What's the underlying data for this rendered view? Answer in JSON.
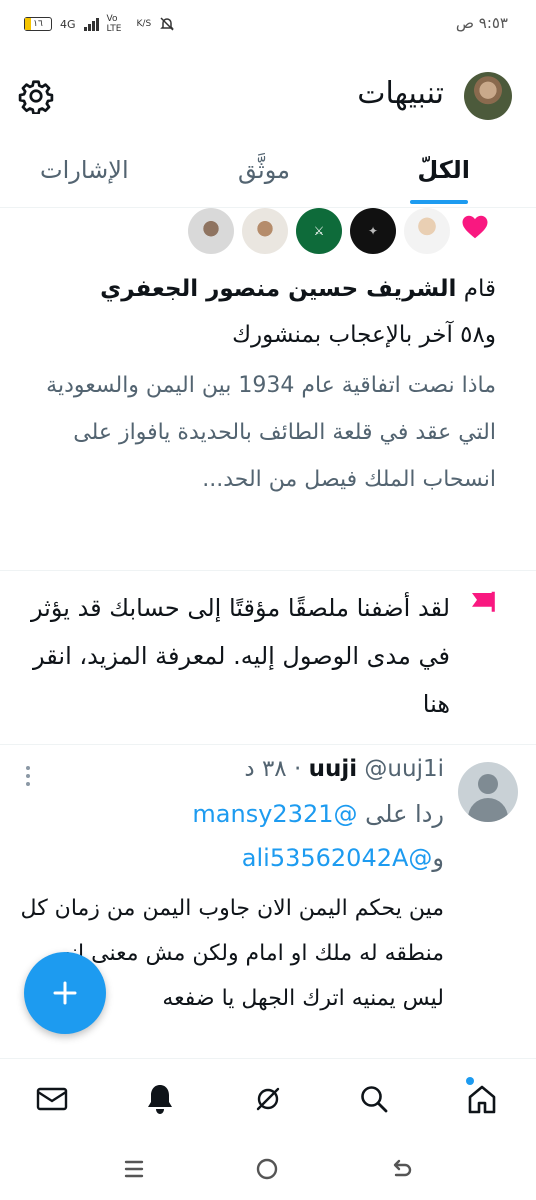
{
  "status_bar": {
    "time": "٩:٥٣ ص",
    "battery": "١٦",
    "network": "4G",
    "volte": "Vo LTE",
    "speed": "K/S"
  },
  "header": {
    "title": "تنبيهات"
  },
  "tabs": [
    {
      "label": "الكلّ",
      "active": true
    },
    {
      "label": "موثَّق",
      "active": false
    },
    {
      "label": "الإشارات",
      "active": false
    }
  ],
  "like_notification": {
    "prefix": "قام",
    "user": "الشريف حسين منصور الجعفري",
    "suffix": "و٥٨ آخر بالإعجاب بمنشورك",
    "excerpt": "ماذا نصت اتفاقية عام 1934 بين اليمن والسعودية التي عقد في قلعة الطائف بالحديدة يافواز على انسحاب الملك فيصل من الحد..."
  },
  "pinned_notice": {
    "text": "لقد أضفنا ملصقًا مؤقتًا إلى حسابك قد يؤثر في مدى الوصول إليه. لمعرفة المزيد، انقر هنا"
  },
  "tweet": {
    "name": "uuji",
    "handle": "@uuj1i",
    "dot": "·",
    "time": "٣٨ د",
    "reply_prefix": "ردا على",
    "mention1": "@mansy2321",
    "reply_and": "و",
    "mention2": "@ali53562042A",
    "body": "مين يحكم اليمن الان جاوب اليمن من زمان كل منطقه له ملك او امام ولكن مش معنى انه ليس يمنيه اترك الجهل يا ضفعه"
  },
  "colors": {
    "accent": "#1d9bf0",
    "like": "#f91880",
    "text": "#0f1419",
    "muted": "#536471"
  }
}
